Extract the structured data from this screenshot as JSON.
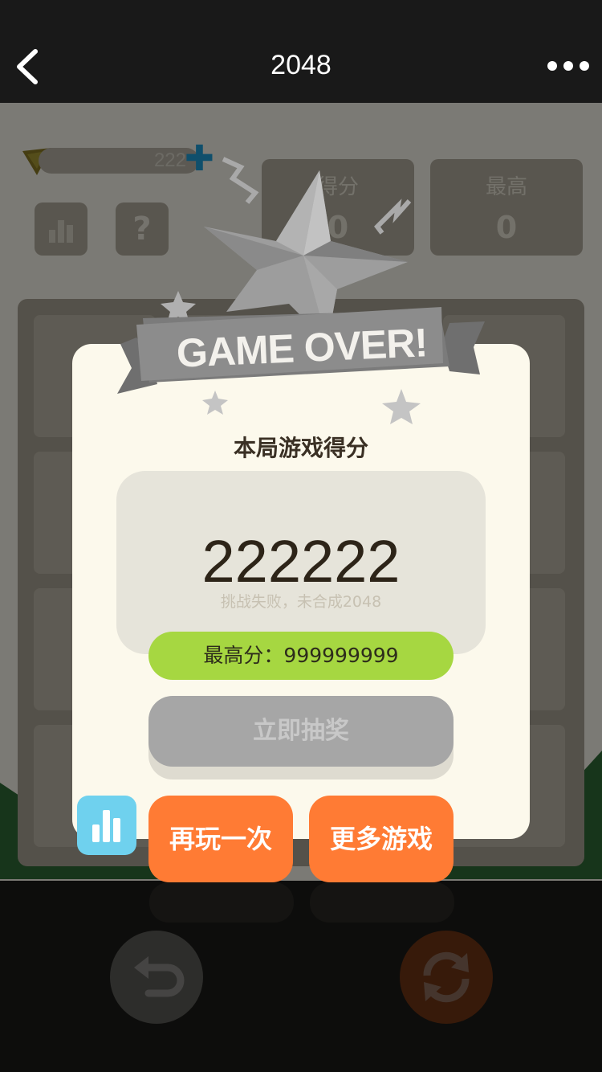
{
  "nav": {
    "title": "2048",
    "back_icon": "chevron-left-icon",
    "more_icon": "more-dots-icon"
  },
  "game_background": {
    "coins": "222",
    "current_score_label": "得分",
    "current_score_value": "0",
    "best_score_label": "最高",
    "best_score_value": "0",
    "help_label": "?"
  },
  "result": {
    "banner": "GAME OVER!",
    "title": "本局游戏得分",
    "score": "222222",
    "fail_message": "挑战失败，未合成2048",
    "best_score": "最高分：999999999",
    "lottery_button": "立即抽奖",
    "retry_button": "再玩一次",
    "more_games_button": "更多游戏"
  },
  "colors": {
    "nav_bg": "#191919",
    "best_pill": "#a6d741",
    "action_orange": "#ff7b34",
    "rank_blue": "#6fd1ee",
    "lottery_disabled": "#a6a6a6"
  }
}
